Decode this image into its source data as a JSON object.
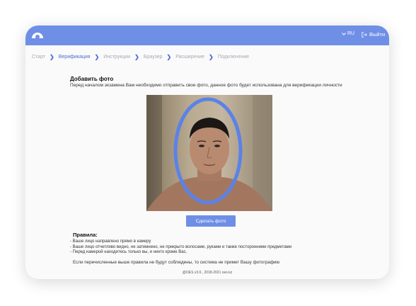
{
  "header": {
    "logo_icon": "eye-logo-icon",
    "language": "RU",
    "language_icon": "chevron-down-icon",
    "logout_label": "Выйти",
    "logout_icon": "logout-icon",
    "accent_color": "#6f8fe6"
  },
  "breadcrumbs": [
    {
      "label": "Старт",
      "state": "done"
    },
    {
      "label": "Верификация",
      "state": "active"
    },
    {
      "label": "Инструкции",
      "state": "todo"
    },
    {
      "label": "Браузер",
      "state": "todo"
    },
    {
      "label": "Расширение",
      "state": "todo"
    },
    {
      "label": "Подключение",
      "state": "todo"
    }
  ],
  "main": {
    "title": "Добавить фото",
    "subtitle": "Перед началом экзамена Вам необходимо отправить свое фото, данное фото будет использована для верификации личности",
    "take_photo_label": "Сделать фото"
  },
  "rules": {
    "title": "Правила:",
    "items": [
      "- Ваше лицо направлено прямо в камеру",
      "- Ваше лицо отчетливо видно, не затемнено, не прикрыто волосами, руками и также посторонними предметами",
      "- Перед камерой находитесь только вы, и никто кроме Вас."
    ],
    "note": "Если перечисленные выше правила не будут соблюдены, то система не примет Вашу фотографию"
  },
  "footer": {
    "text": "@OES v3.0., 2018-2021 oes.kz"
  }
}
